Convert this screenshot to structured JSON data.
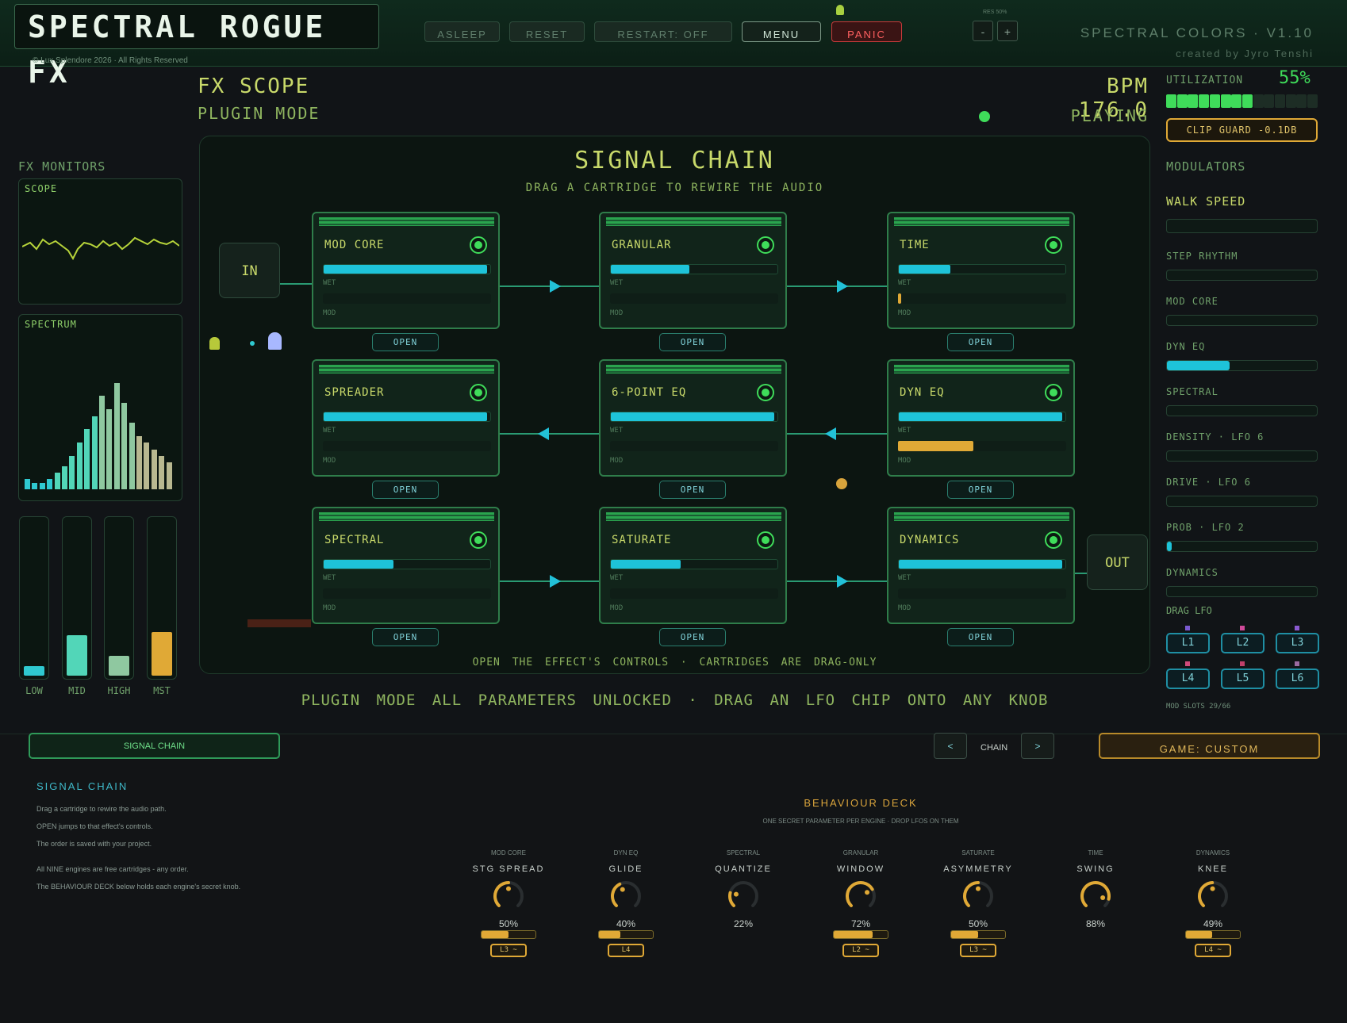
{
  "app": {
    "logo": "SPECTRAL ROGUE FX",
    "copyright": "© Lux Splendore 2026 · All Rights Reserved",
    "brand": "SPECTRAL COLORS · V1.10",
    "credit": "created by Jyro Tenshi"
  },
  "toolbar": {
    "asleep": "ASLEEP",
    "reset": "RESET",
    "restart": "RESTART: OFF",
    "menu": "MENU",
    "panic": "PANIC",
    "res_label": "RES 50%",
    "res_minus": "-",
    "res_plus": "+"
  },
  "header": {
    "title": "FX SCOPE",
    "mode": "PLUGIN MODE",
    "bpm": "BPM 176.0",
    "status": "PLAYING"
  },
  "monitors": {
    "label": "FX MONITORS",
    "scope": "SCOPE",
    "spectrum": "SPECTRUM",
    "spectrum_bars": [
      3,
      2,
      2,
      3,
      5,
      7,
      10,
      14,
      18,
      22,
      28,
      24,
      32,
      26,
      20,
      16,
      14,
      12,
      10,
      8
    ],
    "vu": [
      {
        "label": "LOW",
        "level": 0.06,
        "color": "#2fc9d0"
      },
      {
        "label": "MID",
        "level": 0.26,
        "color": "#52d6b8"
      },
      {
        "label": "HIGH",
        "level": 0.13,
        "color": "#8fc8a0"
      },
      {
        "label": "MST",
        "level": 0.28,
        "color": "#e0a936"
      }
    ]
  },
  "chain": {
    "title": "SIGNAL CHAIN",
    "subtitle": "DRAG A CARTRIDGE TO REWIRE THE AUDIO",
    "in": "IN",
    "out": "OUT",
    "wet_label": "WET",
    "mod_label": "MOD",
    "open_label": "OPEN",
    "footer": "OPEN  THE EFFECT'S CONTROLS  ·  CARTRIDGES ARE DRAG-ONLY",
    "cartridges": [
      {
        "name": "MOD CORE",
        "wet": 0.98,
        "mod": 0.0
      },
      {
        "name": "GRANULAR",
        "wet": 0.47,
        "mod": 0.0
      },
      {
        "name": "TIME",
        "wet": 0.31,
        "mod": 0.02
      },
      {
        "name": "SPREADER",
        "wet": 0.98,
        "mod": 0.0
      },
      {
        "name": "6-POINT EQ",
        "wet": 0.98,
        "mod": 0.0
      },
      {
        "name": "DYN EQ",
        "wet": 0.98,
        "mod": 0.45
      },
      {
        "name": "SPECTRAL",
        "wet": 0.42,
        "mod": 0.0
      },
      {
        "name": "SATURATE",
        "wet": 0.42,
        "mod": 0.0
      },
      {
        "name": "DYNAMICS",
        "wet": 0.98,
        "mod": 0.0
      }
    ]
  },
  "mode_line": "PLUGIN MODE   ALL PARAMETERS UNLOCKED   ·   DRAG AN LFO CHIP ONTO ANY KNOB",
  "right": {
    "util_label": "UTILIZATION",
    "util_value": "55%",
    "util_level": 0.55,
    "clip_guard": "CLIP GUARD -0.1DB",
    "modulators": "MODULATORS",
    "walk_speed": "WALK SPEED",
    "mods": [
      {
        "label": "STEP RHYTHM",
        "level": 0.0
      },
      {
        "label": "MOD CORE",
        "level": 0.0
      },
      {
        "label": "DYN EQ",
        "level": 0.42
      },
      {
        "label": "SPECTRAL",
        "level": 0.0
      },
      {
        "label": "DENSITY · LFO 6",
        "level": 0.0
      },
      {
        "label": "DRIVE · LFO 6",
        "level": 0.0
      },
      {
        "label": "PROB · LFO 2",
        "level": 0.03
      },
      {
        "label": "DYNAMICS",
        "level": 0.0
      }
    ],
    "drag_lfo": "DRAG LFO",
    "lfos": [
      "L1",
      "L2",
      "L3",
      "L4",
      "L5",
      "L6"
    ],
    "mod_slots": "MOD SLOTS 29/66"
  },
  "bottom": {
    "tab": "SIGNAL CHAIN",
    "prev": "<",
    "next": ">",
    "nav_label": "CHAIN",
    "game": "GAME: CUSTOM",
    "help_title": "SIGNAL CHAIN",
    "help": [
      "Drag a cartridge to rewire the audio path.",
      "OPEN jumps to that effect's controls.",
      "The order is saved with your project.",
      "All NINE engines are free cartridges - any order.",
      "The BEHAVIOUR DECK below holds each engine's secret knob."
    ],
    "deck_title": "BEHAVIOUR DECK",
    "deck_sub": "ONE SECRET PARAMETER PER ENGINE · DROP LFOS ON THEM",
    "knobs": [
      {
        "engine": "MOD CORE",
        "param": "STG SPREAD",
        "value": "50%",
        "level": 0.5,
        "chip": "L3 ~"
      },
      {
        "engine": "DYN EQ",
        "param": "GLIDE",
        "value": "40%",
        "level": 0.4,
        "chip": "L4"
      },
      {
        "engine": "SPECTRAL",
        "param": "QUANTIZE",
        "value": "22%",
        "level": 0.22,
        "chip": ""
      },
      {
        "engine": "GRANULAR",
        "param": "WINDOW",
        "value": "72%",
        "level": 0.72,
        "chip": "L2 ~"
      },
      {
        "engine": "SATURATE",
        "param": "ASYMMETRY",
        "value": "50%",
        "level": 0.5,
        "chip": "L3 ~"
      },
      {
        "engine": "TIME",
        "param": "SWING",
        "value": "88%",
        "level": 0.88,
        "chip": ""
      },
      {
        "engine": "DYNAMICS",
        "param": "KNEE",
        "value": "49%",
        "level": 0.49,
        "chip": "L4 ~"
      }
    ]
  },
  "colors": {
    "accent": "#1ec3d9",
    "mod": "#e0a936",
    "led": "#3fdc5a",
    "panic": "#c83a3a"
  }
}
